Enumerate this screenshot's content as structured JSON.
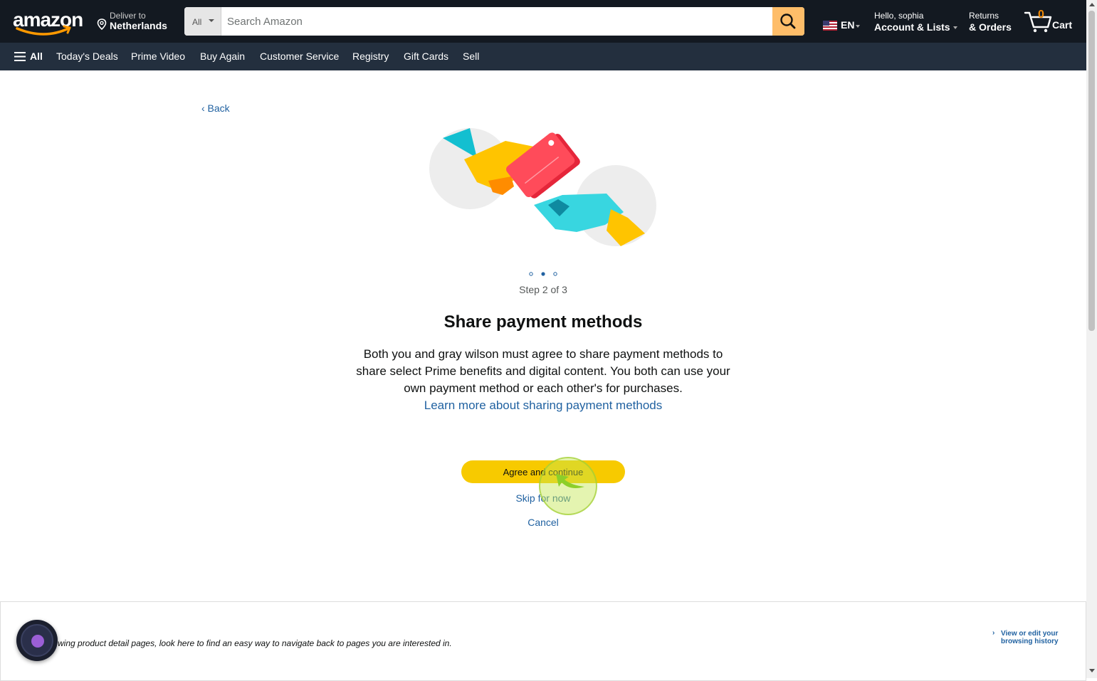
{
  "header": {
    "logo": "amazon",
    "deliver": {
      "line1": "Deliver to",
      "line2": "Netherlands"
    },
    "search": {
      "category": "All",
      "placeholder": "Search Amazon"
    },
    "language": "EN",
    "account": {
      "line1": "Hello, sophia",
      "line2": "Account & Lists"
    },
    "orders": {
      "line1": "Returns",
      "line2": "& Orders"
    },
    "cart": {
      "count": "0",
      "label": "Cart"
    }
  },
  "nav": {
    "all": "All",
    "items": [
      "Today's Deals",
      "Prime Video",
      "Buy Again",
      "Customer Service",
      "Registry",
      "Gift Cards",
      "Sell"
    ]
  },
  "main": {
    "back": "‹ Back",
    "step": "Step 2 of 3",
    "title": "Share payment methods",
    "description": "Both you and gray wilson must agree to share payment methods to share select Prime benefits and digital content. You both can use your own payment method or each other's for purchases.",
    "learn_more": "Learn more about sharing payment methods",
    "agree_button": "Agree and continue",
    "skip": "Skip for now",
    "cancel": "Cancel"
  },
  "footer": {
    "browsing_text": "wing product detail pages, look here to find an easy way to navigate back to pages you are interested in.",
    "view_history": "View or edit your browsing history"
  },
  "colors": {
    "topbar": "#131921",
    "navbar": "#232f3e",
    "search_button": "#febd69",
    "primary_button": "#f7ca00",
    "link": "#2162a1",
    "cart_count": "#f08804"
  }
}
